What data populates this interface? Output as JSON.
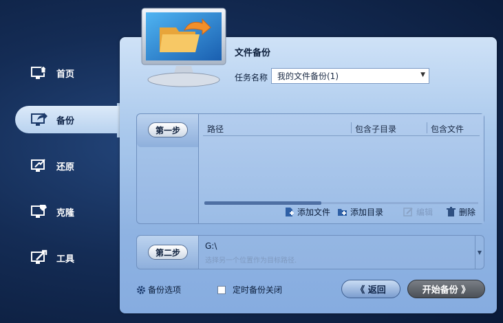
{
  "sidebar": {
    "items": [
      {
        "label": "首页",
        "icon": "home-monitor-icon",
        "active": false
      },
      {
        "label": "备份",
        "icon": "backup-monitor-icon",
        "active": true
      },
      {
        "label": "还原",
        "icon": "restore-monitor-icon",
        "active": false
      },
      {
        "label": "克隆",
        "icon": "clone-monitor-icon",
        "active": false
      },
      {
        "label": "工具",
        "icon": "tools-monitor-icon",
        "active": false
      }
    ]
  },
  "header": {
    "title": "文件备份",
    "task_name_label": "任务名称",
    "task_name_value": "我的文件备份(1)"
  },
  "step1": {
    "label": "第一步",
    "columns": [
      "路径",
      "包含子目录",
      "包含文件"
    ],
    "rows": [],
    "actions": {
      "add_file": "添加文件",
      "add_dir": "添加目录",
      "edit": "编辑",
      "delete": "删除"
    }
  },
  "step2": {
    "label": "第二步",
    "dest_value": "G:\\",
    "dest_hint": "选择另一个位置作为目标路径."
  },
  "footer": {
    "options_label": "备份选项",
    "schedule_label": "定时备份关闭",
    "schedule_checked": false,
    "back_label": "《 返回",
    "start_label": "开始备份 》"
  },
  "colors": {
    "background": "#142c55",
    "panel": "#a9c8ec",
    "start_button": "#4b5057"
  }
}
